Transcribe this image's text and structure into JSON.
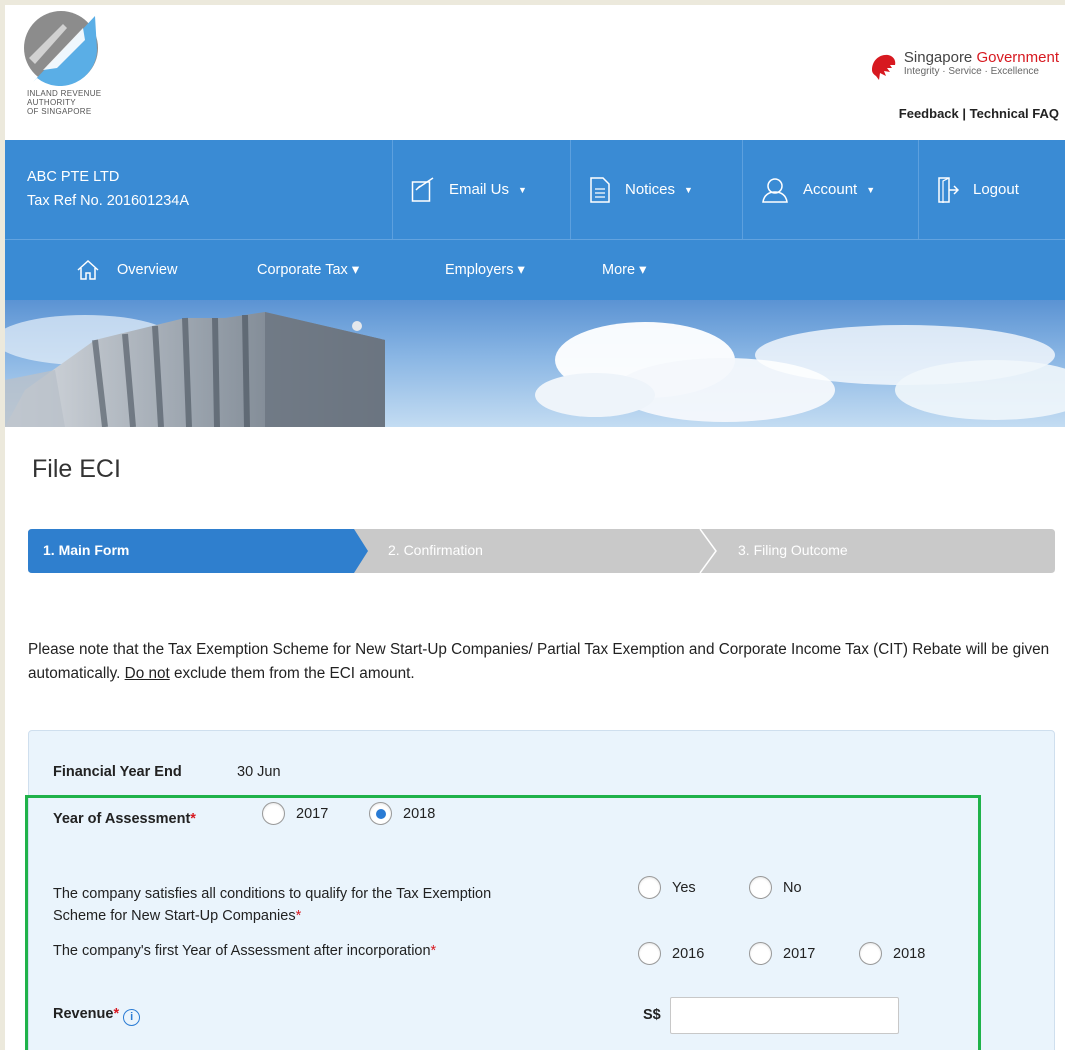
{
  "header": {
    "logo_lines": [
      "INLAND REVENUE",
      "AUTHORITY",
      "OF SINGAPORE"
    ],
    "gov_brand": {
      "word1": "Singapore",
      "word2": "Government",
      "tagline": "Integrity · Service · Excellence"
    },
    "links": {
      "feedback": "Feedback",
      "separator": "|",
      "faq": "Technical FAQ"
    }
  },
  "account_bar": {
    "company_name": "ABC PTE LTD",
    "tax_ref": "Tax Ref No. 201601234A",
    "email_label": "Email Us",
    "notices_label": "Notices",
    "account_label": "Account",
    "logout_label": "Logout",
    "caret": "▼"
  },
  "nav": {
    "overview": "Overview",
    "corporate_tax": "Corporate Tax ▾",
    "employers": "Employers ▾",
    "more": "More ▾"
  },
  "page": {
    "title": "File ECI"
  },
  "steps": [
    {
      "label": "1. Main Form",
      "active": true
    },
    {
      "label": "2. Confirmation",
      "active": false
    },
    {
      "label": "3. Filing Outcome",
      "active": false
    }
  ],
  "notice": {
    "part1": "Please note that the Tax Exemption Scheme for New Start-Up Companies/ Partial Tax Exemption and Corporate Income Tax (CIT) Rebate will be given automatically. ",
    "underline": "Do not",
    "part2": " exclude them from the ECI amount."
  },
  "form": {
    "fye_label": "Financial Year End",
    "fye_value": "30 Jun",
    "ya_label": "Year of Assessment",
    "ya_options": [
      "2017",
      "2018"
    ],
    "ya_selected": "2018",
    "startup_line1": "The company satisfies all conditions to qualify for the Tax Exemption",
    "startup_line2": "Scheme for New Start-Up Companies",
    "startup_options": [
      "Yes",
      "No"
    ],
    "first_ya_label": "The company's first Year of Assessment after incorporation",
    "first_ya_options": [
      "2016",
      "2017",
      "2018"
    ],
    "revenue_label": "Revenue",
    "currency": "S$",
    "revenue_value": "",
    "required_mark": "*",
    "info_glyph": "i"
  },
  "colors": {
    "brand_blue": "#3a8bd4",
    "step_active": "#2f7fce",
    "step_inactive": "#c9c9c9",
    "highlight_green": "#1fb24a",
    "required_red": "#d71920"
  }
}
